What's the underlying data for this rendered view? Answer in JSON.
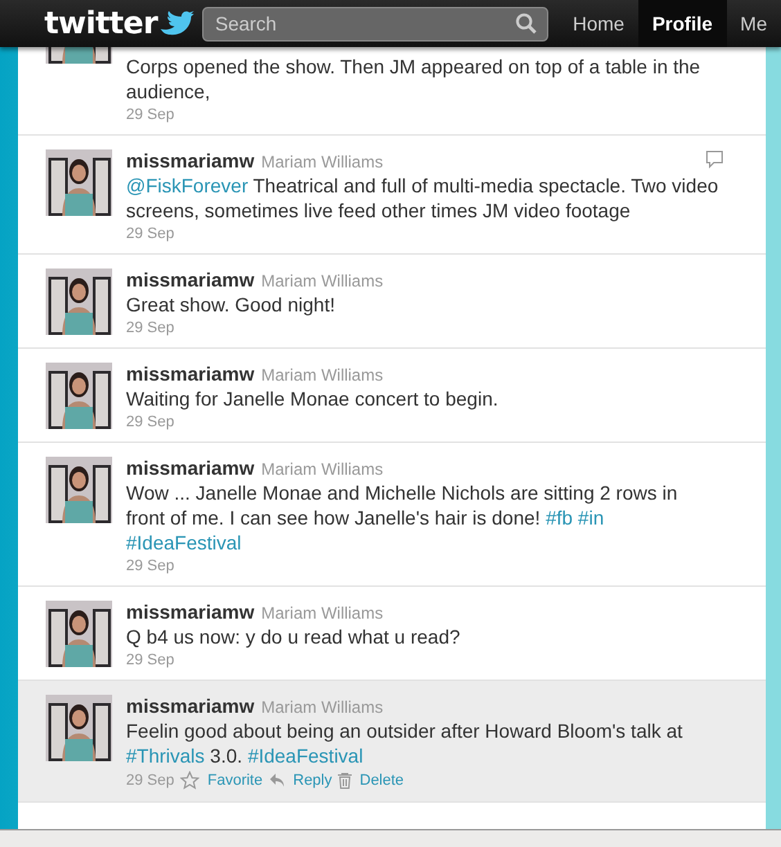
{
  "header": {
    "logo": "twitter",
    "search": {
      "placeholder": "Search"
    },
    "nav": [
      {
        "label": "Home",
        "selected": false
      },
      {
        "label": "Profile",
        "selected": true
      },
      {
        "label": "Me",
        "selected": false
      }
    ]
  },
  "tweets": [
    {
      "text": [
        {
          "kind": "plain",
          "text": "Corps opened the show. Then JM appeared on top of a table in the audience,"
        }
      ],
      "date": "29 Sep",
      "highlighted": false,
      "cut": true
    },
    {
      "username": "missmariamw",
      "full_name": "Mariam Williams",
      "text": [
        {
          "kind": "link",
          "text": "@FiskForever"
        },
        {
          "kind": "plain",
          "text": " Theatrical and full of multi-media spectacle. Two video screens, sometimes live feed other times JM video footage"
        }
      ],
      "date": "29 Sep",
      "highlighted": false,
      "reply_icon": true
    },
    {
      "username": "missmariamw",
      "full_name": "Mariam Williams",
      "text": [
        {
          "kind": "plain",
          "text": "Great show. Good night!"
        }
      ],
      "date": "29 Sep",
      "highlighted": false
    },
    {
      "username": "missmariamw",
      "full_name": "Mariam Williams",
      "text": [
        {
          "kind": "plain",
          "text": "Waiting for Janelle Monae concert to begin."
        }
      ],
      "date": "29 Sep",
      "highlighted": false
    },
    {
      "username": "missmariamw",
      "full_name": "Mariam Williams",
      "text": [
        {
          "kind": "plain",
          "text": "Wow ... Janelle Monae and Michelle Nichols are sitting 2 rows in front of me. I can see how Janelle's hair is done! "
        },
        {
          "kind": "link",
          "text": "#fb"
        },
        {
          "kind": "link",
          "text": "#in"
        },
        {
          "kind": "link",
          "text": "#IdeaFestival"
        }
      ],
      "date": "29 Sep",
      "highlighted": false
    },
    {
      "username": "missmariamw",
      "full_name": "Mariam Williams",
      "text": [
        {
          "kind": "plain",
          "text": "Q b4 us now: y do u read what u read?"
        }
      ],
      "date": "29 Sep",
      "highlighted": false
    },
    {
      "username": "missmariamw",
      "full_name": "Mariam Williams",
      "text": [
        {
          "kind": "plain",
          "text": "Feelin good about being an outsider after Howard Bloom's talk at "
        },
        {
          "kind": "link",
          "text": "#Thrivals"
        },
        {
          "kind": "plain",
          "text": " 3.0. "
        },
        {
          "kind": "link",
          "text": "#IdeaFestival"
        }
      ],
      "date": "29 Sep",
      "highlighted": true,
      "actions": [
        {
          "kind": "favorite",
          "label": "Favorite"
        },
        {
          "kind": "reply",
          "label": "Reply"
        },
        {
          "kind": "delete",
          "label": "Delete"
        }
      ]
    }
  ]
}
